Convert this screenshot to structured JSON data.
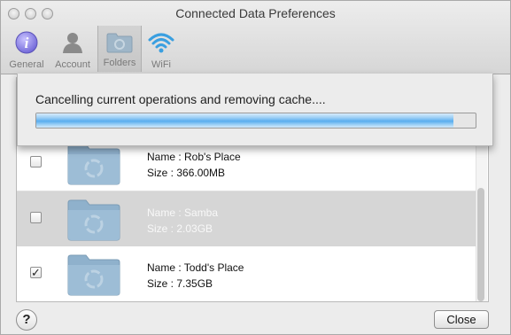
{
  "window": {
    "title": "Connected Data Preferences"
  },
  "toolbar": {
    "items": [
      {
        "label": "General",
        "icon": "info-icon",
        "selected": false
      },
      {
        "label": "Account",
        "icon": "person-icon",
        "selected": false
      },
      {
        "label": "Folders",
        "icon": "folder-icon",
        "selected": true
      },
      {
        "label": "WiFi",
        "icon": "wifi-icon",
        "selected": false
      }
    ]
  },
  "sheet": {
    "message": "Cancelling current operations and removing cache....",
    "progress_fraction": 0.95
  },
  "folders": [
    {
      "name": "Name : Rob's Place",
      "size": "Size : 366.00MB",
      "checked": false,
      "selected": false
    },
    {
      "name": "Name : Samba",
      "size": "Size : 2.03GB",
      "checked": false,
      "selected": true
    },
    {
      "name": "Name : Todd's Place",
      "size": "Size : 7.35GB",
      "checked": true,
      "selected": false
    }
  ],
  "footer": {
    "help_label": "?",
    "close_label": "Close"
  },
  "colors": {
    "progress_accent": "#5aaeef",
    "selected_row": "#d6d6d6"
  }
}
